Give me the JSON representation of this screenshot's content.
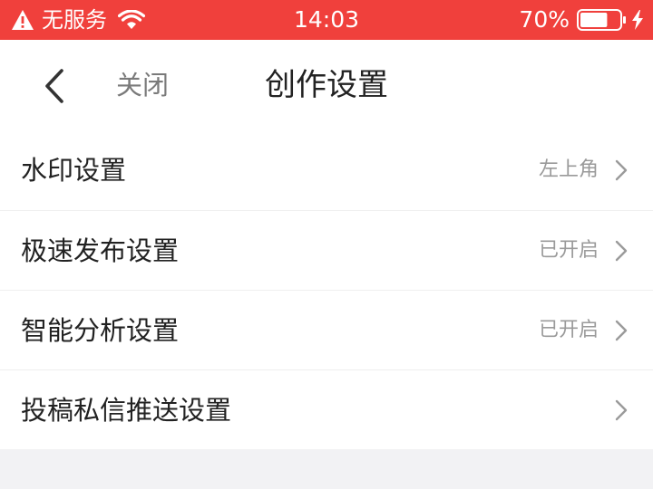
{
  "status_bar": {
    "carrier": "无服务",
    "time": "14:03",
    "battery_percent": "70%",
    "battery_level": 0.7,
    "background_color": "#f0403c",
    "icons": [
      "warning-icon",
      "wifi-icon",
      "battery-icon",
      "charging-bolt-icon"
    ]
  },
  "nav": {
    "back_icon": "chevron-left-icon",
    "close_label": "关闭",
    "title": "创作设置"
  },
  "settings": [
    {
      "label": "水印设置",
      "value": "左上角"
    },
    {
      "label": "极速发布设置",
      "value": "已开启"
    },
    {
      "label": "智能分析设置",
      "value": "已开启"
    },
    {
      "label": "投稿私信推送设置",
      "value": ""
    }
  ],
  "colors": {
    "accent": "#f0403c",
    "page_background": "#f2f2f4",
    "secondary_text": "#9a9a9a"
  }
}
